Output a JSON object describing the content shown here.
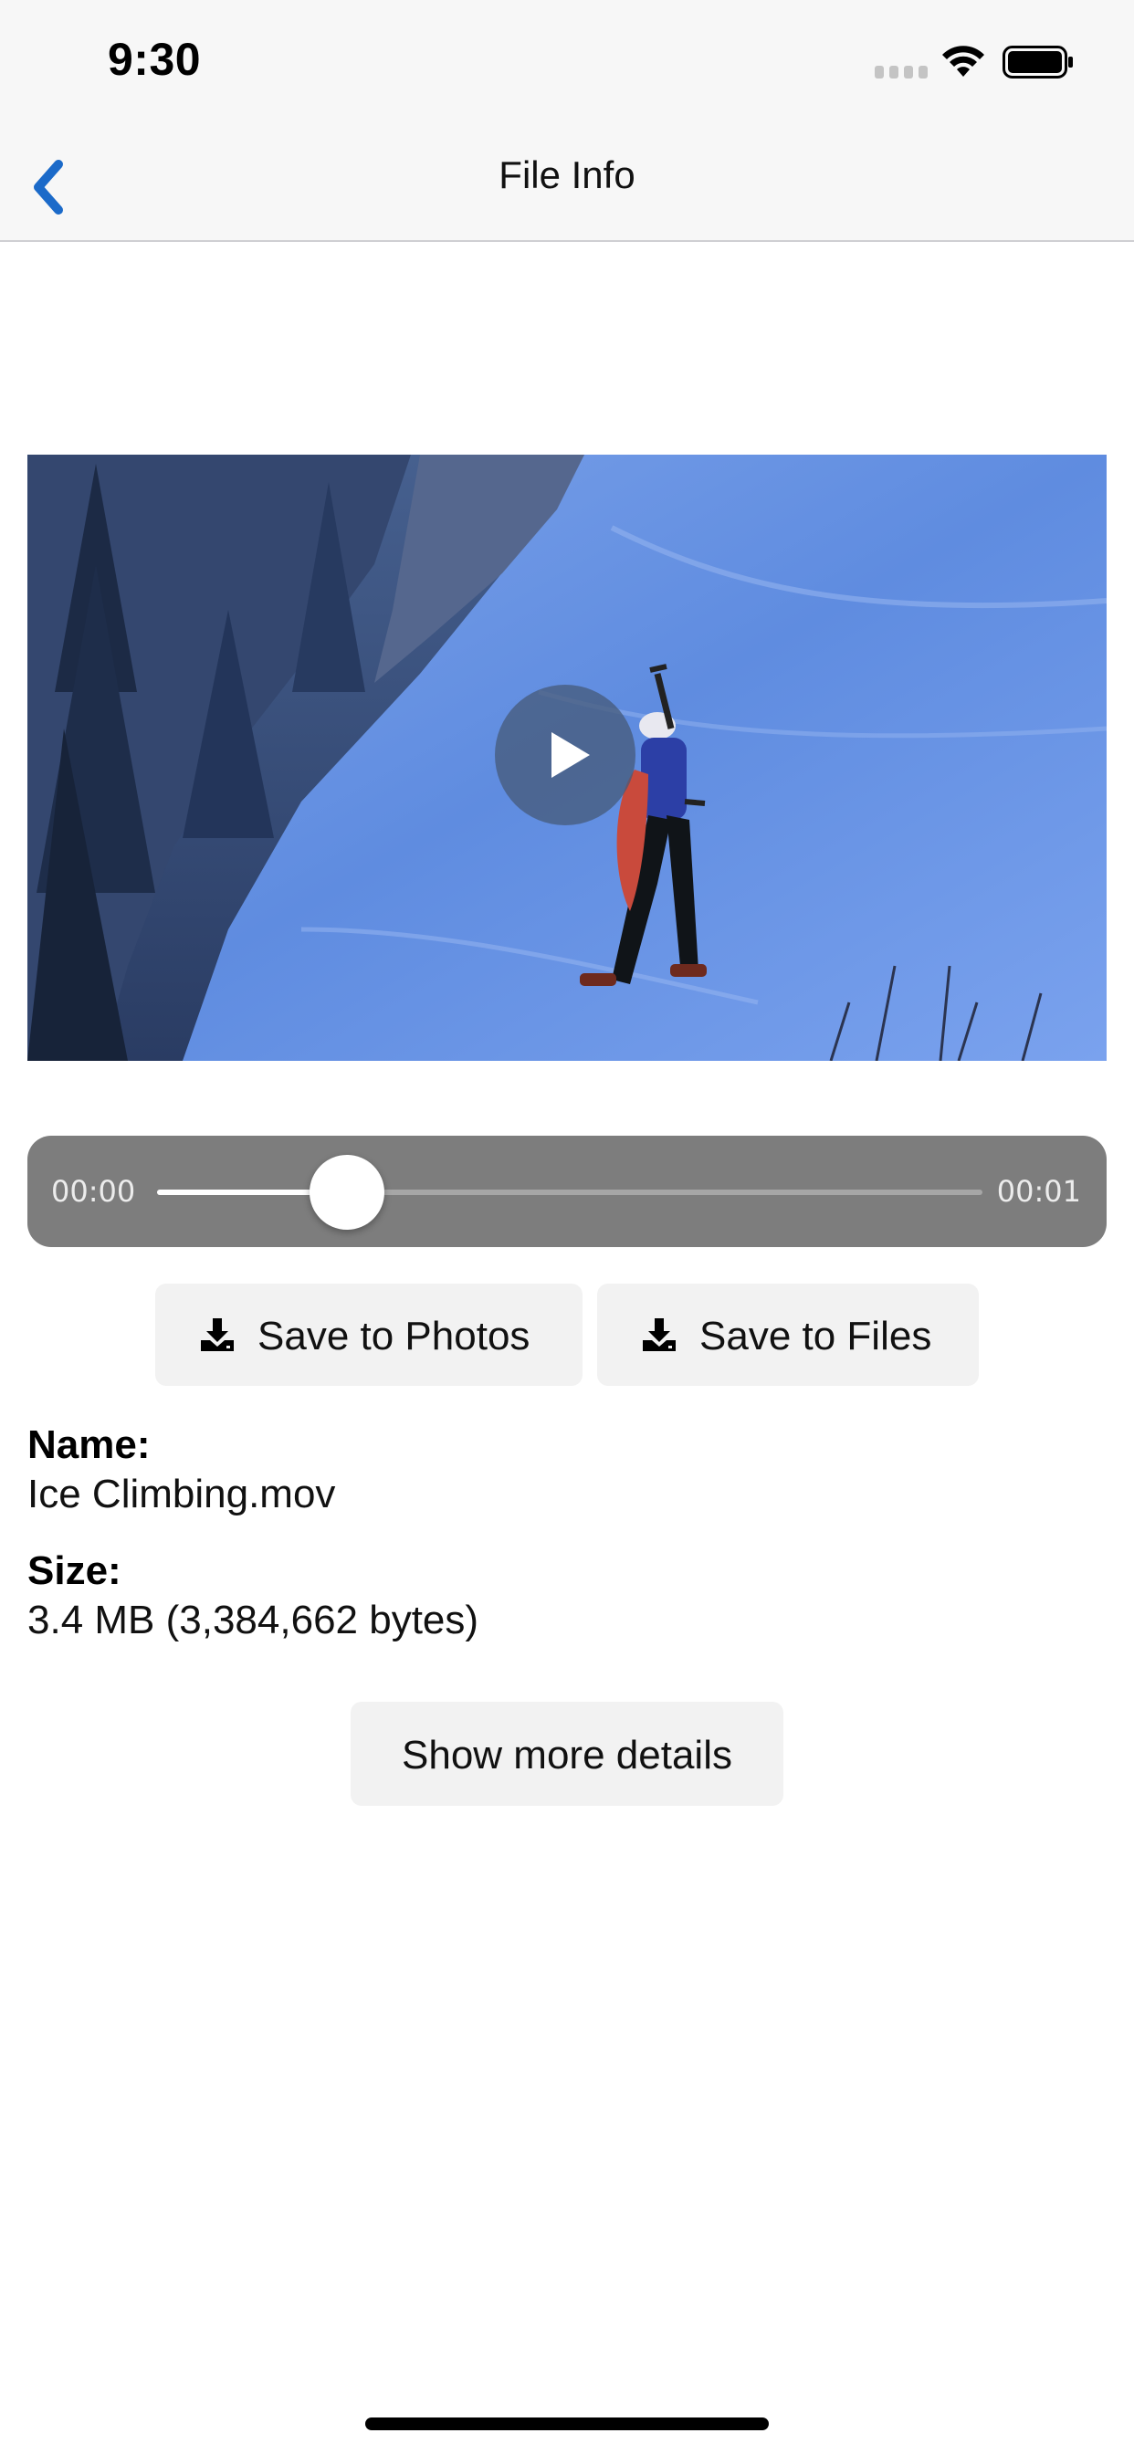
{
  "status_bar": {
    "time": "9:30",
    "icons": [
      "cellular-signal-icon",
      "wifi-icon",
      "battery-icon"
    ]
  },
  "nav": {
    "title": "File Info",
    "back_icon": "chevron-left-icon",
    "accent_color": "#1b6ac9"
  },
  "player": {
    "play_icon": "play-icon",
    "elapsed": "00:00",
    "total": "00:01",
    "progress_fraction": 0.23
  },
  "actions": {
    "save_photos_label": "Save to Photos",
    "save_files_label": "Save to Files",
    "icon": "download-icon"
  },
  "info": {
    "name_label": "Name:",
    "name_value": "Ice Climbing.mov",
    "size_label": "Size:",
    "size_value": "3.4 MB (3,384,662 bytes)"
  },
  "more_button_label": "Show more details"
}
